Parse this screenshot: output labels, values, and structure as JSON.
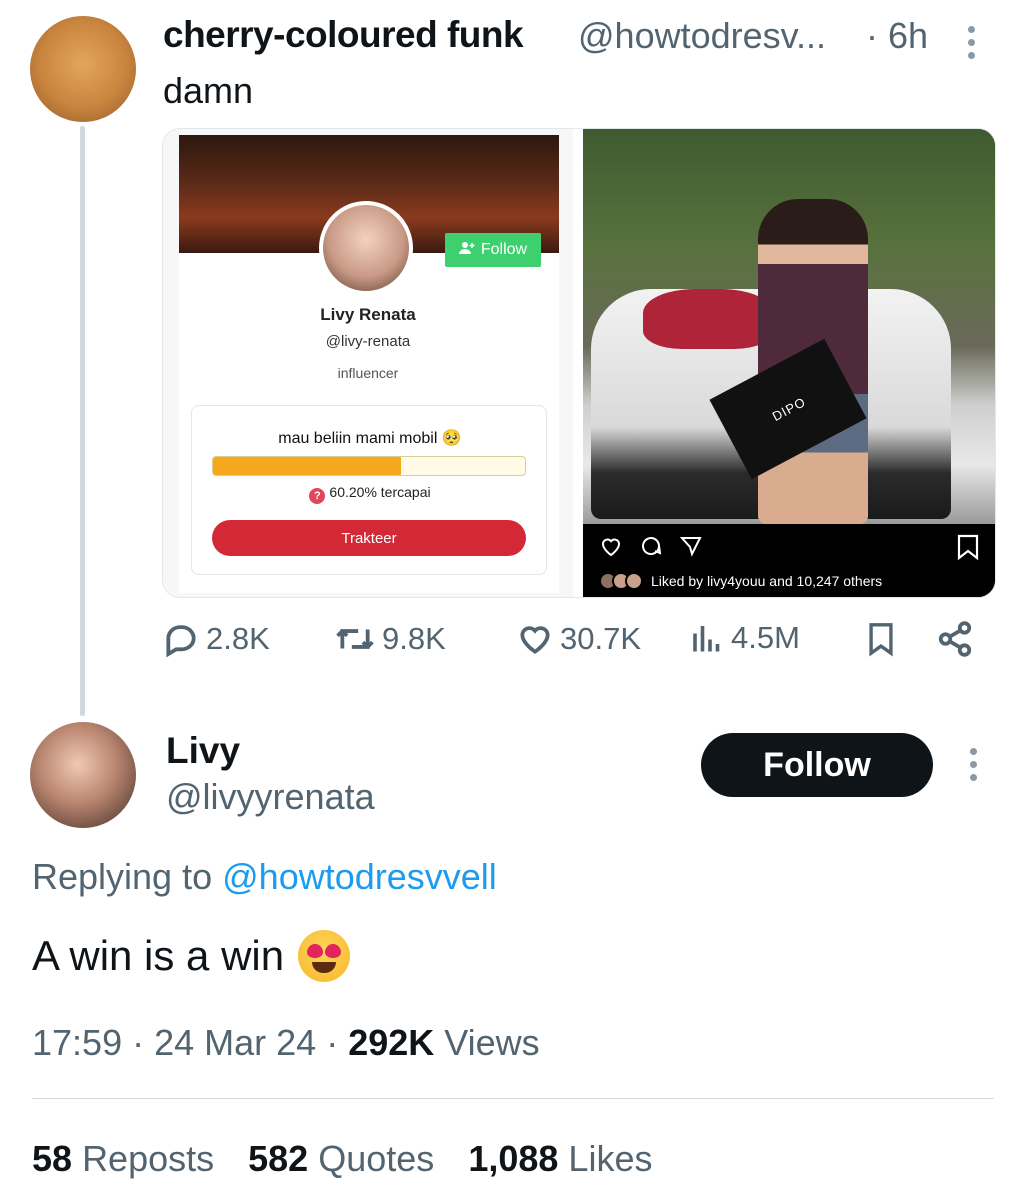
{
  "tweet": {
    "author_name": "cherry-coloured funk",
    "author_handle": "@howtodresv...",
    "time": "· 6h",
    "text": "damn"
  },
  "media_left": {
    "follow_label": "Follow",
    "name": "Livy Renata",
    "handle": "@livy-renata",
    "role": "influencer",
    "goal_title": "mau beliin mami mobil 🥺",
    "progress_fraction": 0.602,
    "progress_text": "60.20% tercapai",
    "progress_icon": "?",
    "button_label": "Trakteer"
  },
  "media_right": {
    "bag_label": "DIPO",
    "liked_text": "Liked by livy4youu and 10,247 others"
  },
  "actions": {
    "replies": "2.8K",
    "reposts": "9.8K",
    "likes": "30.7K",
    "views": "4.5M"
  },
  "reply": {
    "name": "Livy",
    "handle": "@livyyrenata",
    "follow_label": "Follow",
    "replying_prefix": "Replying to",
    "replying_handle": "@howtodresvvell",
    "text": "A win is a win",
    "time": "17:59",
    "date": "24 Mar 24",
    "views_count": "292K",
    "views_label": "Views",
    "reposts_count": "58",
    "reposts_label": "Reposts",
    "quotes_count": "582",
    "quotes_label": "Quotes",
    "likes_count": "1,088",
    "likes_label": "Likes"
  },
  "colors": {
    "link": "#1d9bf0",
    "muted": "#536471",
    "text": "#0f1419",
    "progress": "#f5a81b",
    "trakteer": "#d32835"
  }
}
